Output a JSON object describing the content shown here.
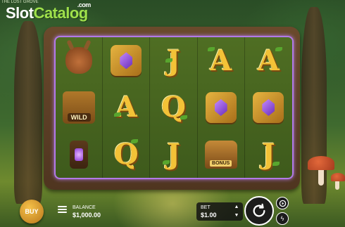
{
  "brand": {
    "logo_slot": "Slot",
    "logo_catalog": "Catalog",
    "logo_com": ".com"
  },
  "game": {
    "subtitle": "THE LOST GROVE"
  },
  "reels": [
    [
      "deer",
      "gem",
      "J",
      "A",
      "A"
    ],
    [
      "wild",
      "A",
      "Q",
      "gem",
      "gem"
    ],
    [
      "lantern",
      "Q",
      "J",
      "chest",
      "J"
    ]
  ],
  "symbols": {
    "wild_label": "WILD",
    "bonus_label": "BONUS"
  },
  "controls": {
    "buy_label": "BUY",
    "balance_label": "BALANCE",
    "balance_value": "$1,000.00",
    "bet_label": "BET",
    "bet_value": "$1.00"
  },
  "colors": {
    "frame_glow": "#b27ae8",
    "gold": "#f3c237",
    "gem": "#8a3cd6"
  },
  "icons": [
    "menu-icon",
    "chevron-up-icon",
    "chevron-down-icon",
    "spin-icon",
    "autoplay-icon",
    "turbo-icon"
  ]
}
